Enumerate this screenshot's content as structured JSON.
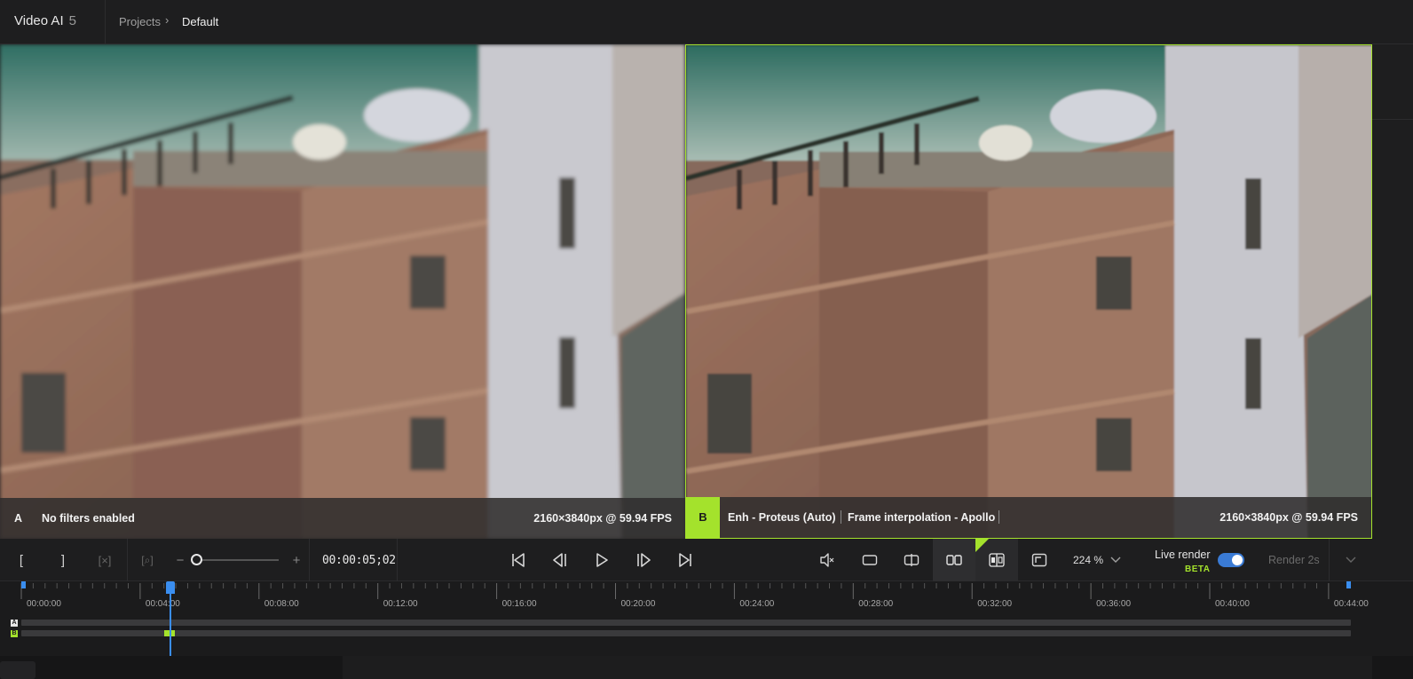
{
  "app": {
    "name": "Video AI",
    "version": "5"
  },
  "breadcrumb": {
    "projects": "Projects",
    "chevron": "›",
    "current": "Default"
  },
  "viewer_a": {
    "letter": "A",
    "filters": "No filters enabled",
    "resolution": "2160×3840px @ 59.94 FPS"
  },
  "viewer_b": {
    "letter": "B",
    "filter1": "Enh - Proteus (Auto)",
    "filter2": "Frame interpolation -  Apollo",
    "resolution": "2160×3840px @ 59.94 FPS"
  },
  "controls": {
    "mark_in": "[",
    "mark_out": "]",
    "clear_marks": "[×]",
    "zoom_to_fit": "[⌕]",
    "zoom_minus": "−",
    "zoom_plus": "+",
    "timecode": "00:00:05;02",
    "zoom_level": "224 %",
    "live_render": "Live render",
    "beta": "BETA",
    "live_render_on": true,
    "render_button": "Render 2s",
    "timeline_zoom_fraction": 0.0
  },
  "timeline": {
    "ticks": [
      "00:00:00",
      "00:04:00",
      "00:08:00",
      "00:12:00",
      "00:16:00",
      "00:20:00",
      "00:24:00",
      "00:28:00",
      "00:32:00",
      "00:36:00",
      "00:40:00",
      "00:44:00"
    ],
    "track_a": "A",
    "track_b": "B"
  },
  "colors": {
    "accent": "#a4e22c",
    "playhead": "#3a8ef0",
    "toggle": "#3a7bd5"
  },
  "icons": [
    "mute-icon",
    "single-view-icon",
    "split-view-icon",
    "side-by-side-icon",
    "compare-ab-icon",
    "crop-icon",
    "chevron-down-icon",
    "skip-start-icon",
    "prev-frame-icon",
    "play-icon",
    "next-frame-icon",
    "skip-end-icon"
  ]
}
